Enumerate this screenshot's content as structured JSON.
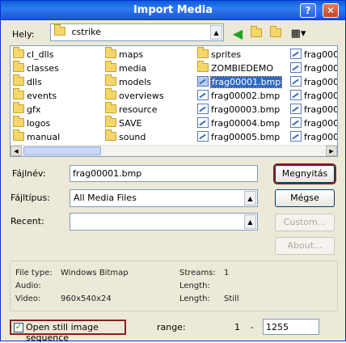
{
  "window": {
    "title": "Import Media",
    "help_glyph": "?",
    "close_glyph": "✕"
  },
  "location": {
    "label": "Hely:",
    "value": "cstrike"
  },
  "files": {
    "col1": [
      "cl_dlls",
      "classes",
      "dlls",
      "events",
      "gfx",
      "logos",
      "manual"
    ],
    "col2": [
      "maps",
      "media",
      "models",
      "overviews",
      "resource",
      "SAVE",
      "sound"
    ],
    "col3_folders": [
      "sprites",
      "ZOMBIEDEMO"
    ],
    "col3_bmps": [
      "frag00001.bmp",
      "frag00002.bmp",
      "frag00003.bmp",
      "frag00004.bmp",
      "frag00005.bmp"
    ],
    "col4": [
      "frag000",
      "frag000",
      "frag000",
      "frag000",
      "frag000",
      "frag000",
      "frag000"
    ],
    "selected": "frag00001.bmp"
  },
  "form": {
    "filename_label": "Fájlnév:",
    "filename_value": "frag00001.bmp",
    "filetype_label": "Fájltípus:",
    "filetype_value": "All Media Files",
    "recent_label": "Recent:",
    "recent_value": ""
  },
  "buttons": {
    "open": "Megnyitás",
    "cancel": "Mégse",
    "custom": "Custom...",
    "about": "About..."
  },
  "info": {
    "file_type_label": "File type:",
    "file_type_value": "Windows Bitmap",
    "audio_label": "Audio:",
    "audio_value": "",
    "video_label": "Video:",
    "video_value": "960x540x24",
    "streams_label": "Streams:",
    "streams_value": "1",
    "length1_label": "Length:",
    "length1_value": "",
    "length2_label": "Length:",
    "length2_value": "Still"
  },
  "sequence": {
    "checkbox_label": "Open still image sequence",
    "checked": true,
    "range_label": "range:",
    "range_start": "1",
    "dash": "-",
    "range_end": "1255"
  },
  "icons": {
    "back": "green-back-arrow-icon",
    "up": "folder-up-icon",
    "new_folder": "new-folder-icon",
    "view": "view-menu-icon"
  },
  "colors": {
    "accent": "#316ac5",
    "focus_border": "#8a1e1e"
  }
}
